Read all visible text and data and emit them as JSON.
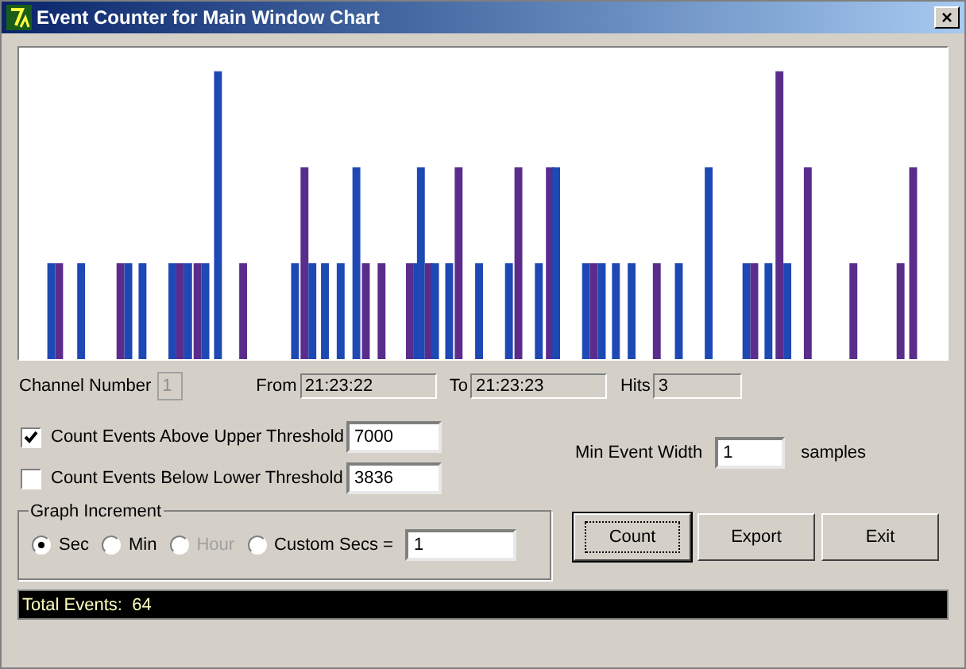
{
  "window": {
    "title": "Event Counter for Main Window Chart",
    "close": "×"
  },
  "channel": {
    "label": "Channel Number",
    "value": "1",
    "disabled": true
  },
  "range": [
    {
      "label": "From",
      "value": "21:23:22"
    },
    {
      "label": "To",
      "value": "21:23:23"
    },
    {
      "label": "Hits",
      "value": "3"
    }
  ],
  "thresholds": [
    {
      "label": "Count Events Above Upper Threshold",
      "checked": true,
      "value": "7000"
    },
    {
      "label": "Count Events Below Lower Threshold",
      "checked": false,
      "value": "3836"
    }
  ],
  "min_event_width": {
    "label": "Min Event Width",
    "value": "1",
    "unit": "samples"
  },
  "graph_increment": {
    "title": "Graph Increment",
    "options": [
      {
        "label": "Sec",
        "selected": true,
        "disabled": false
      },
      {
        "label": "Min",
        "selected": false,
        "disabled": false
      },
      {
        "label": "Hour",
        "selected": false,
        "disabled": true
      },
      {
        "label": "Custom Secs =",
        "selected": false,
        "disabled": false
      }
    ],
    "custom_value": "1"
  },
  "buttons": [
    {
      "label": "Count",
      "focused": true
    },
    {
      "label": "Export",
      "focused": false
    },
    {
      "label": "Exit",
      "focused": false
    }
  ],
  "status_bar": "Total Events:  64"
}
